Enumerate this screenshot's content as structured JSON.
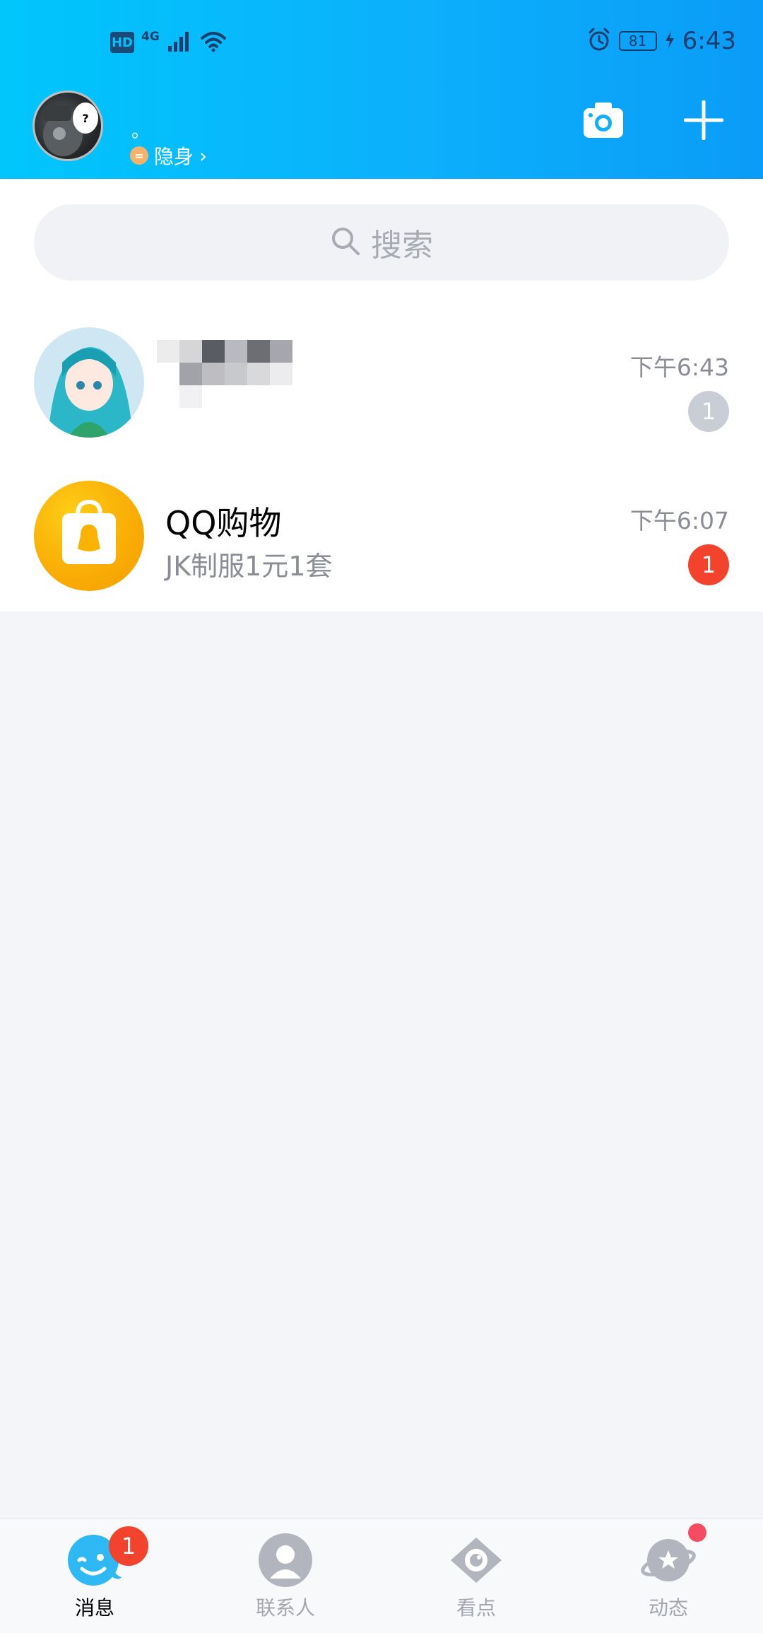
{
  "status_bar": {
    "hd": "HD",
    "network": "4G",
    "battery": "81",
    "time": "6:43"
  },
  "header": {
    "nickname": "。",
    "online_status": "隐身",
    "status_icon_symbol": "=",
    "chevron": "›",
    "camera_icon": "camera-icon",
    "add_icon": "plus-icon"
  },
  "search": {
    "placeholder": "搜索"
  },
  "conversations": [
    {
      "title": "",
      "subtitle": "",
      "time": "下午6:43",
      "unread": "1",
      "badge_style": "muted"
    },
    {
      "title": "QQ购物",
      "subtitle": "JK制服1元1套",
      "time": "下午6:07",
      "unread": "1",
      "badge_style": "red"
    }
  ],
  "tabbar": {
    "tabs": [
      {
        "label": "消息",
        "badge": "1",
        "active": true
      },
      {
        "label": "联系人",
        "active": false
      },
      {
        "label": "看点",
        "active": false
      },
      {
        "label": "动态",
        "active": false,
        "dot": true
      }
    ]
  },
  "colors": {
    "header_gradient_start": "#00c6fc",
    "header_gradient_end": "#0a9cf8",
    "badge_red": "#f4432c",
    "badge_muted": "#c9cdd6",
    "shopping_yellow": "#fbb200"
  }
}
